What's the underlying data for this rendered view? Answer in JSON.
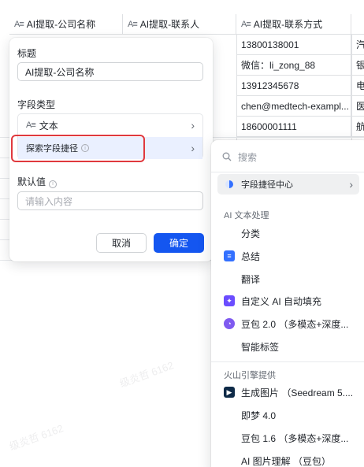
{
  "sheet": {
    "columns": [
      {
        "icon": "A≡",
        "title": "AI提取-公司名称"
      },
      {
        "icon": "A≡",
        "title": "AI提取-联系人"
      },
      {
        "icon": "A≡",
        "title": "AI提取-联系方式"
      }
    ],
    "contact_rows": [
      "13800138001",
      "微信：li_zong_88",
      "13912345678",
      "chen@medtech-exampl...",
      "18600001111"
    ],
    "edge_chars": [
      "汽",
      "银",
      "电",
      "医",
      "航"
    ]
  },
  "field_panel": {
    "title_label": "标题",
    "title_value": "AI提取-公司名称",
    "type_label": "字段类型",
    "type_icon": "A≡",
    "type_value": "文本",
    "shortcut_label": "探索字段捷径",
    "default_label": "默认值",
    "default_placeholder": "请输入内容",
    "cancel": "取消",
    "confirm": "确定"
  },
  "menu": {
    "search_placeholder": "搜索",
    "shortcut_center": "字段捷径中心",
    "group_text": "AI 文本处理",
    "text_items": [
      {
        "label": "分类",
        "icon": ""
      },
      {
        "label": "总结",
        "icon": "summary-icon",
        "color": "#3370ff"
      },
      {
        "label": "翻译",
        "icon": ""
      },
      {
        "label": "自定义 AI 自动填充",
        "icon": "ai-fill-icon",
        "color": "#6b4dff"
      },
      {
        "label": "豆包 2.0 （多模态+深度...",
        "icon": "doubao-icon",
        "color": "#7f5af0"
      },
      {
        "label": "智能标签",
        "icon": ""
      }
    ],
    "group_volc": "火山引擎提供",
    "volc_items": [
      {
        "label": "生成图片 （Seedream 5....",
        "icon": "seedream-icon",
        "color": "#0e2a47"
      },
      {
        "label": "即梦 4.0",
        "icon": ""
      },
      {
        "label": "豆包 1.6 （多模态+深度...",
        "icon": ""
      },
      {
        "label": "AI 图片理解 （豆包）",
        "icon": ""
      }
    ]
  },
  "watermark": "级炎哲 6162"
}
